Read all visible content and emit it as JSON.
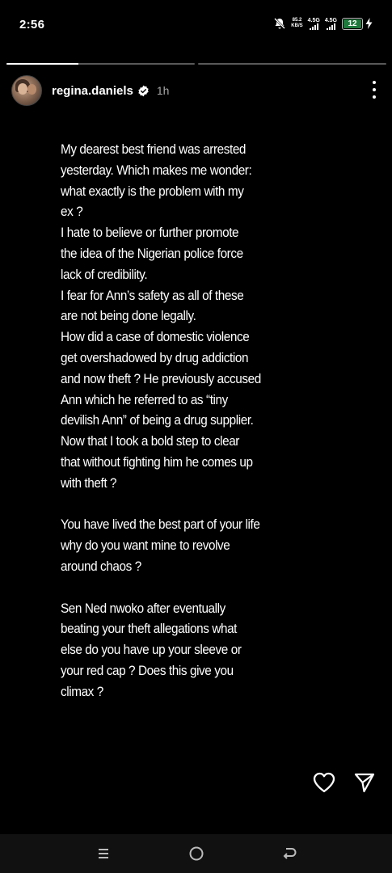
{
  "status_bar": {
    "time": "2:56",
    "net_speed_value": "85.2",
    "net_speed_unit": "KB/S",
    "signal1_label": "4.5G",
    "signal2_label": "4.5G",
    "battery_level": "12"
  },
  "story": {
    "segments": 2,
    "progress": [
      0.38,
      0.0
    ],
    "username": "regina.daniels",
    "time_ago": "1h",
    "paragraphs": [
      [
        "My dearest best friend was arrested",
        "yesterday. Which makes me wonder:",
        "what exactly is the problem with my",
        "ex ?",
        " I hate to believe or further promote",
        "the idea of the Nigerian police force",
        "lack of credibility.",
        "I fear for Ann’s safety as all of these",
        "are not being done legally.",
        "How did a case of domestic violence",
        "get overshadowed by drug addiction",
        "and now theft ? He previously accused",
        "Ann which he referred to as “tiny",
        "devilish Ann” of being a drug supplier.",
        "Now that I took a bold step to clear",
        "that without fighting him he comes up",
        "with theft ?"
      ],
      [
        "You have lived the best part of your life",
        "why do you want mine to revolve",
        "around chaos ?"
      ],
      [
        "Sen Ned nwoko after eventually",
        "beating your theft allegations what",
        "else do you have up your sleeve or",
        "your red cap ? Does this give you",
        "climax ?"
      ]
    ]
  },
  "icons": {
    "mute": "bell-off-icon",
    "verified": "verified-badge-icon",
    "more": "more-vertical-icon",
    "like": "heart-icon",
    "share": "send-icon",
    "nav_recents": "recents-icon",
    "nav_home": "home-icon",
    "nav_back": "back-icon"
  },
  "colors": {
    "background": "#000000",
    "text": "#ffffff",
    "secondary_text": "#a8a8a8",
    "verified": "#ffffff",
    "battery_fill": "#1e7a3c"
  }
}
